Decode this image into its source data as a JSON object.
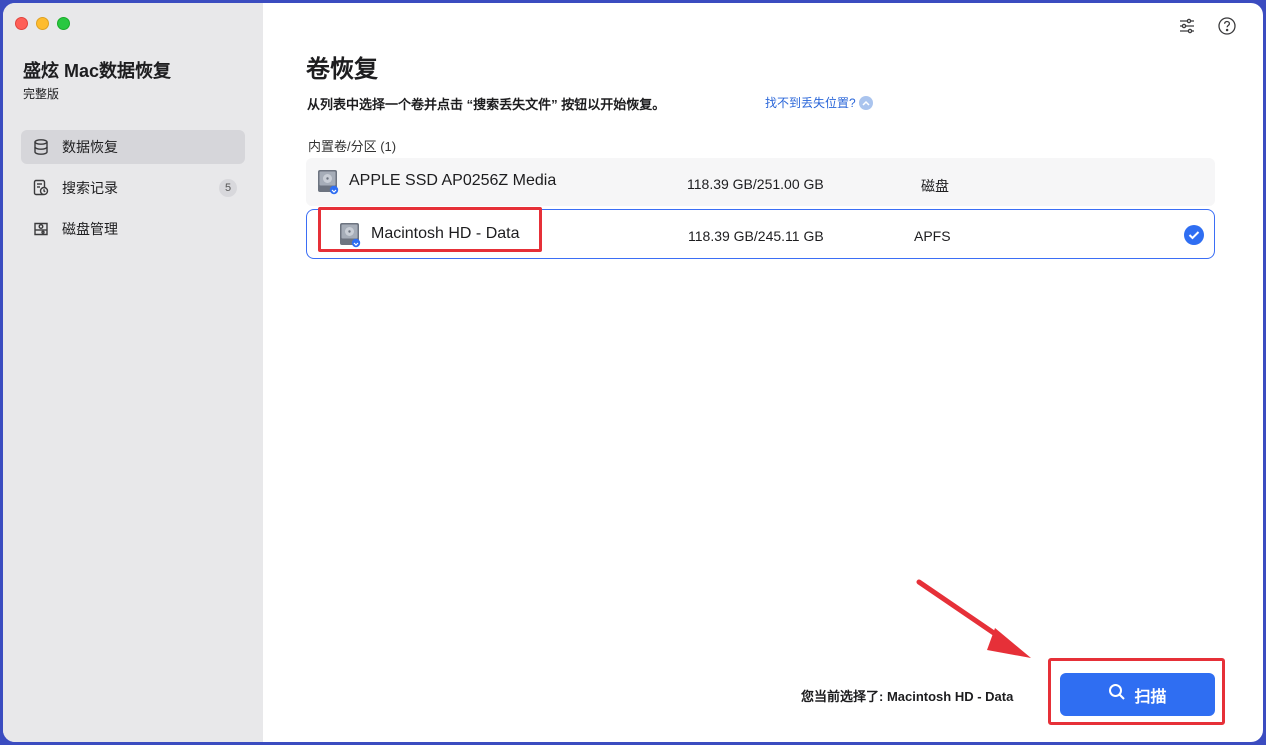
{
  "sidebar": {
    "app_title": "盛炫 Mac数据恢复",
    "edition": "完整版",
    "items": [
      {
        "label": "数据恢复",
        "icon": "database-icon",
        "active": true
      },
      {
        "label": "搜索记录",
        "icon": "history-icon",
        "badge": "5"
      },
      {
        "label": "磁盘管理",
        "icon": "disk-icon"
      }
    ]
  },
  "toolbar": {
    "icons": [
      "settings-sliders-icon",
      "help-icon"
    ]
  },
  "main": {
    "title": "卷恢复",
    "instruction": "从列表中选择一个卷并点击 “搜索丢失文件” 按钮以开始恢复。",
    "help_link": "找不到丢失位置?",
    "section_label": "内置卷/分区 (1)",
    "volumes": [
      {
        "name": "APPLE SSD AP0256Z Media",
        "size": "118.39 GB/251.00 GB",
        "type": "磁盘",
        "selected": false
      },
      {
        "name": "Macintosh HD - Data",
        "size": "118.39 GB/245.11 GB",
        "type": "APFS",
        "selected": true
      }
    ],
    "status_text": "您当前选择了: Macintosh HD - Data",
    "scan_label": "扫描"
  },
  "colors": {
    "accent": "#2f6ef2",
    "annotation": "#e63038",
    "sidebar_bg": "#e8e8ea",
    "frame": "#3b4cc0"
  }
}
